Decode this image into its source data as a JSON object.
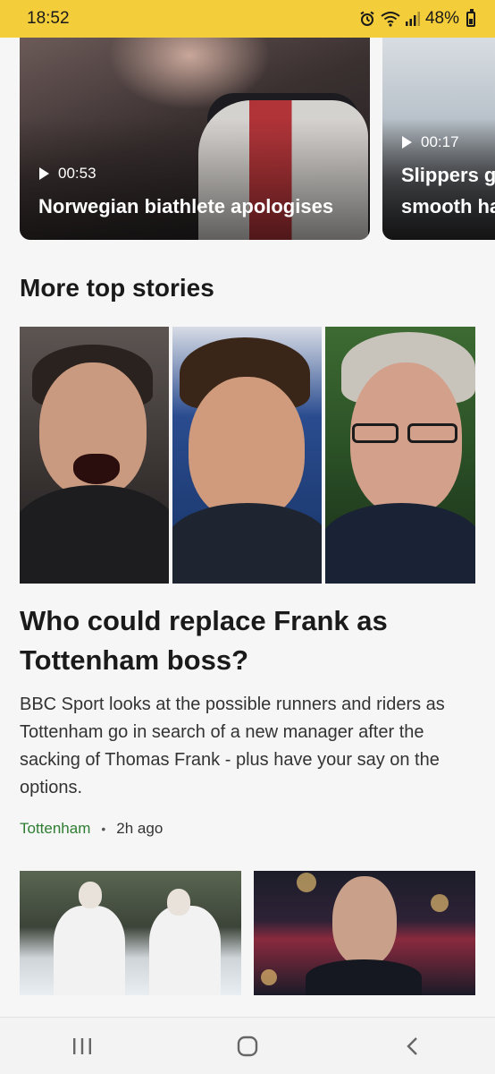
{
  "status_bar": {
    "time": "18:52",
    "battery_text": "48%",
    "icons": [
      "alarm-icon",
      "wifi-icon",
      "signal-icon",
      "battery-icon"
    ],
    "background": "#f4cd3a"
  },
  "video_carousel": {
    "items": [
      {
        "duration": "00:53",
        "title": "Norwegian biathlete apologises"
      },
      {
        "duration": "00:17",
        "title_line1": "Slippers g",
        "title_line2": "smooth ha"
      }
    ]
  },
  "section": {
    "title": "More top stories"
  },
  "lead_story": {
    "headline": "Who could replace Frank as Tottenham boss?",
    "summary": "BBC Sport looks at the possible runners and riders as Tottenham go in search of a new manager after the sacking of Thomas Frank - plus have your say on the options.",
    "tag": "Tottenham",
    "separator": "•",
    "time": "2h ago",
    "tag_color": "#2e7d32"
  },
  "nav_bar": {
    "buttons": [
      "recent-apps-icon",
      "home-icon",
      "back-icon"
    ]
  }
}
